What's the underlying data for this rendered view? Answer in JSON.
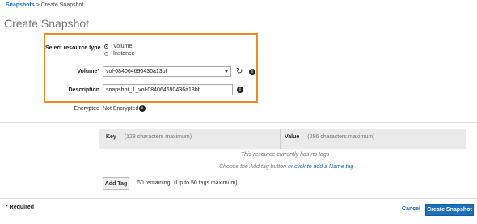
{
  "breadcrumb": {
    "link": "Snapshots",
    "separator": ">",
    "current": "Create Snapshot"
  },
  "page_title": "Create Snapshot",
  "form": {
    "resource_type_label": "Select resource type",
    "resource_options": [
      "Volume",
      "Instance"
    ],
    "selected_resource": "Volume",
    "volume_label": "Volume*",
    "volume_value": "vol-084064690436a13bf",
    "description_label": "Description",
    "description_value": "snapshot_1_vol-084064690436a13bf",
    "encrypted_label": "Encrypted",
    "encrypted_value": "Not Encrypted"
  },
  "tags": {
    "key_header": "Key",
    "key_hint": "(128 characters maximum)",
    "value_header": "Value",
    "value_hint": "(256 characters maximum)",
    "empty_message": "This resource currently has no tags",
    "help_prefix": "Choose the Add tag button or",
    "help_link": "click to add a Name tag",
    "add_button": "Add Tag",
    "remaining": "50 remaining",
    "max_note": "(Up to 50 tags maximum)"
  },
  "footer": {
    "required_note": "* Required",
    "cancel_label": "Cancel",
    "create_label": "Create Snapshot"
  },
  "colors": {
    "highlight": "#f08a24",
    "link": "#1166bb",
    "primary_button": "#1f6fba"
  }
}
